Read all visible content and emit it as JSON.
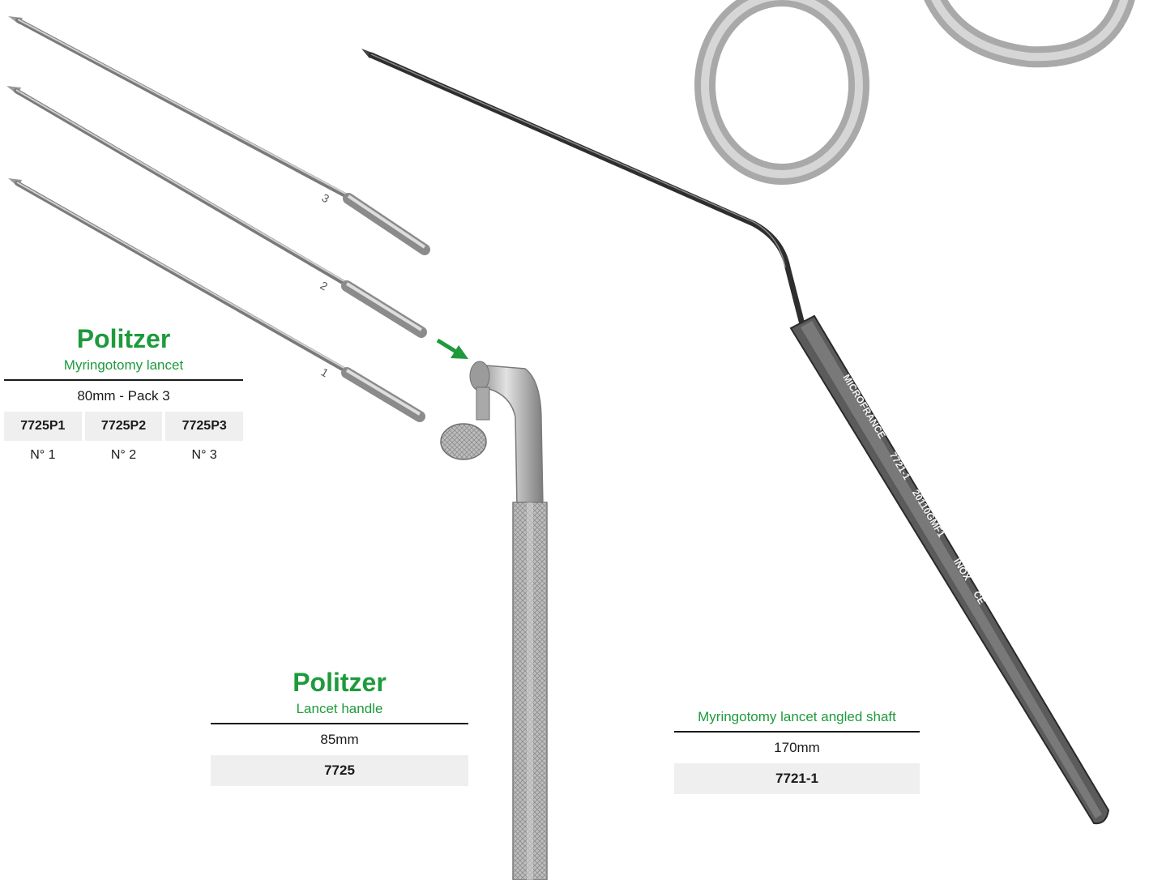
{
  "colors": {
    "accent_green": "#1e9a3c",
    "steel": "#b7b7b7",
    "dark_steel": "#3d3d3d",
    "shade": "#efefef"
  },
  "icons": {
    "arrow": "arrow-right-down-icon"
  },
  "lancets": {
    "title": "Politzer",
    "subtitle": "Myringotomy lancet",
    "spec": "80mm - Pack 3",
    "codes": [
      "7725P1",
      "7725P2",
      "7725P3"
    ],
    "numbers": [
      "N° 1",
      "N° 2",
      "N° 3"
    ],
    "blade_marks": [
      "3",
      "2",
      "1"
    ]
  },
  "handle": {
    "title": "Politzer",
    "subtitle": "Lancet handle",
    "spec": "85mm",
    "code": "7725"
  },
  "angled": {
    "subtitle": "Myringotomy lancet angled shaft",
    "spec": "170mm",
    "code": "7721-1",
    "engraving": {
      "brand": "MICROFRANCE",
      "ref": "7721-1",
      "lot": "20110GMF1",
      "material": "INOX",
      "mark": "CE"
    }
  }
}
